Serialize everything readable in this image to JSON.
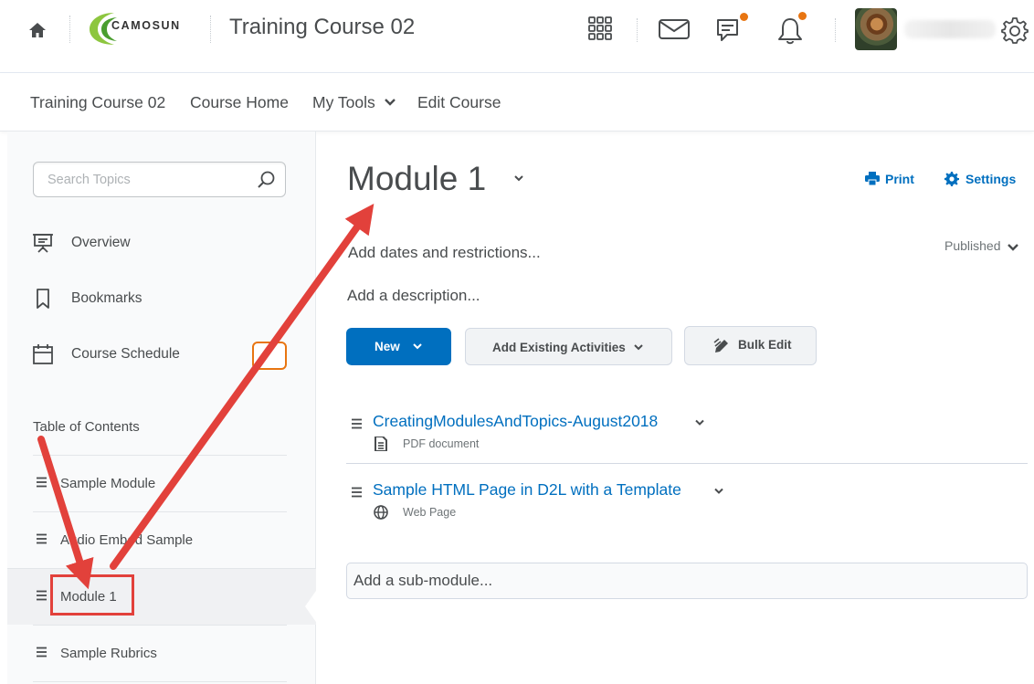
{
  "header": {
    "brand_name": "CAMOSUN",
    "course_title": "Training Course 02",
    "icons": [
      "home-icon",
      "app-grid-icon",
      "mail-icon",
      "chat-icon",
      "bell-icon",
      "gear-icon"
    ],
    "notification_color": "#e87511"
  },
  "nav": {
    "items": [
      "Training Course 02",
      "Course Home",
      "My Tools",
      "Edit Course"
    ]
  },
  "sidebar": {
    "search_placeholder": "Search Topics",
    "links": [
      {
        "label": "Overview",
        "icon": "presentation-icon"
      },
      {
        "label": "Bookmarks",
        "icon": "bookmark-icon"
      },
      {
        "label": "Course Schedule",
        "icon": "calendar-icon"
      }
    ],
    "toc_title": "Table of Contents",
    "toc_items": [
      {
        "label": "Sample Module",
        "active": false
      },
      {
        "label": "Audio Embed Sample",
        "active": false
      },
      {
        "label": "Module 1",
        "active": true
      },
      {
        "label": "Sample Rubrics",
        "active": false
      }
    ]
  },
  "main": {
    "module_title": "Module 1",
    "print_label": "Print",
    "settings_label": "Settings",
    "add_dates": "Add dates and restrictions...",
    "status": "Published",
    "add_description": "Add a description...",
    "buttons": {
      "new": "New",
      "add_existing": "Add Existing Activities",
      "bulk_edit": "Bulk Edit"
    },
    "topics": [
      {
        "title": "CreatingModulesAndTopics-August2018",
        "type": "PDF document",
        "icon": "document-icon"
      },
      {
        "title": "Sample HTML Page in D2L with a Template",
        "type": "Web Page",
        "icon": "globe-icon"
      }
    ],
    "add_submodule": "Add a sub-module..."
  },
  "colors": {
    "link": "#006fbf",
    "primary_button": "#006fbf",
    "annotation": "#e2413b"
  }
}
